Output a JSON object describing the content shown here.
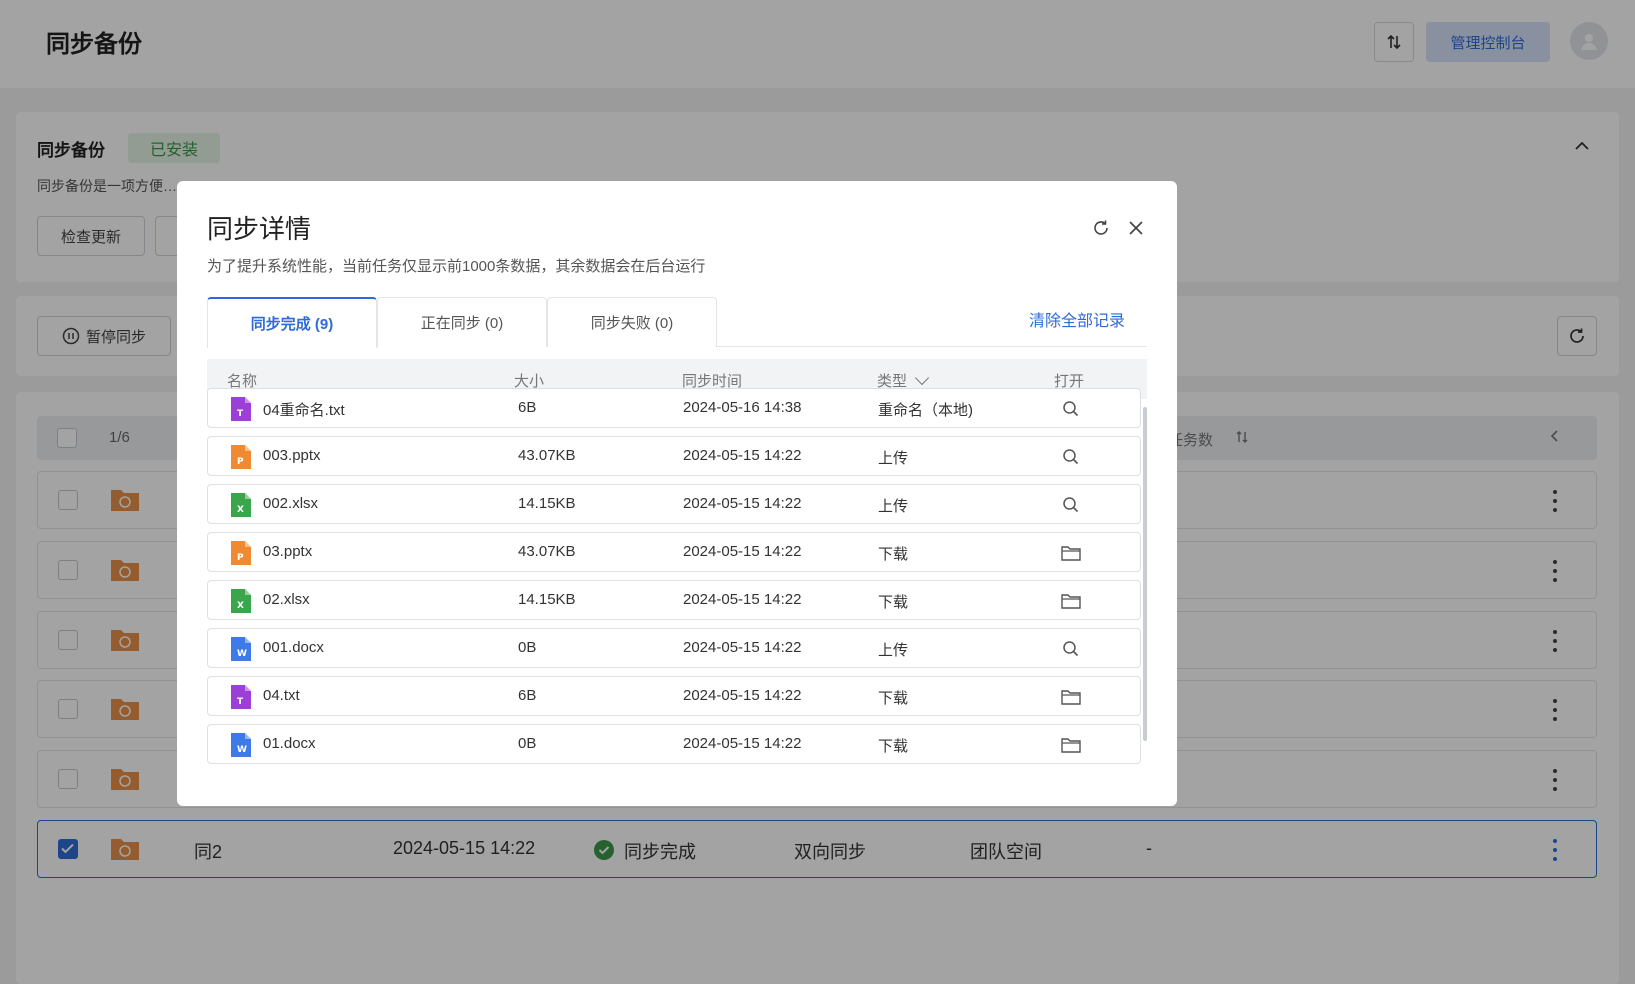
{
  "page": {
    "title": "同步备份",
    "sort_icon": "sort-arrows-icon",
    "console_label": "管理控制台",
    "avatar_icon": "user-avatar-icon"
  },
  "app": {
    "name": "同步备份",
    "badge": "已安装",
    "description": "同步备份是一项方便…",
    "check_update_label": "检查更新"
  },
  "toolbar": {
    "pause_label": "暂停同步"
  },
  "task_table": {
    "page_count": "1/6",
    "tasks_header": "任务数",
    "selected_row": {
      "name": "同2",
      "time": "2024-05-15 14:22",
      "status": "同步完成",
      "direction": "双向同步",
      "space": "团队空间",
      "extra": "-"
    }
  },
  "modal": {
    "title": "同步详情",
    "notice": "为了提升系统性能，当前任务仅显示前1000条数据，其余数据会在后台运行",
    "tabs": [
      {
        "label": "同步完成 (9)",
        "active": true
      },
      {
        "label": "正在同步 (0)",
        "active": false
      },
      {
        "label": "同步失败 (0)",
        "active": false
      }
    ],
    "clear_label": "清除全部记录",
    "columns": {
      "name": "名称",
      "size": "大小",
      "time": "同步时间",
      "type": "类型",
      "open": "打开"
    },
    "rows": [
      {
        "icon": "txt-file-icon",
        "name": "04重命名.txt",
        "size": "6B",
        "time": "2024-05-16 14:38",
        "type": "重命名（本地)",
        "action": "search-icon"
      },
      {
        "icon": "pptx-file-icon",
        "name": "003.pptx",
        "size": "43.07KB",
        "time": "2024-05-15 14:22",
        "type": "上传",
        "action": "search-icon"
      },
      {
        "icon": "xlsx-file-icon",
        "name": "002.xlsx",
        "size": "14.15KB",
        "time": "2024-05-15 14:22",
        "type": "上传",
        "action": "search-icon"
      },
      {
        "icon": "pptx-file-icon",
        "name": "03.pptx",
        "size": "43.07KB",
        "time": "2024-05-15 14:22",
        "type": "下载",
        "action": "folder-icon"
      },
      {
        "icon": "xlsx-file-icon",
        "name": "02.xlsx",
        "size": "14.15KB",
        "time": "2024-05-15 14:22",
        "type": "下载",
        "action": "folder-icon"
      },
      {
        "icon": "docx-file-icon",
        "name": "001.docx",
        "size": "0B",
        "time": "2024-05-15 14:22",
        "type": "上传",
        "action": "search-icon"
      },
      {
        "icon": "txt-file-icon",
        "name": "04.txt",
        "size": "6B",
        "time": "2024-05-15 14:22",
        "type": "下载",
        "action": "folder-icon"
      },
      {
        "icon": "docx-file-icon",
        "name": "01.docx",
        "size": "0B",
        "time": "2024-05-15 14:22",
        "type": "下载",
        "action": "folder-icon"
      }
    ]
  },
  "colors": {
    "accent": "#2f6bd7",
    "success": "#3a9a4a",
    "txt": "#9b3fd6",
    "pptx": "#f08a32",
    "xlsx": "#3aa54b",
    "docx": "#3f7be8",
    "folder": "#e9924a"
  }
}
